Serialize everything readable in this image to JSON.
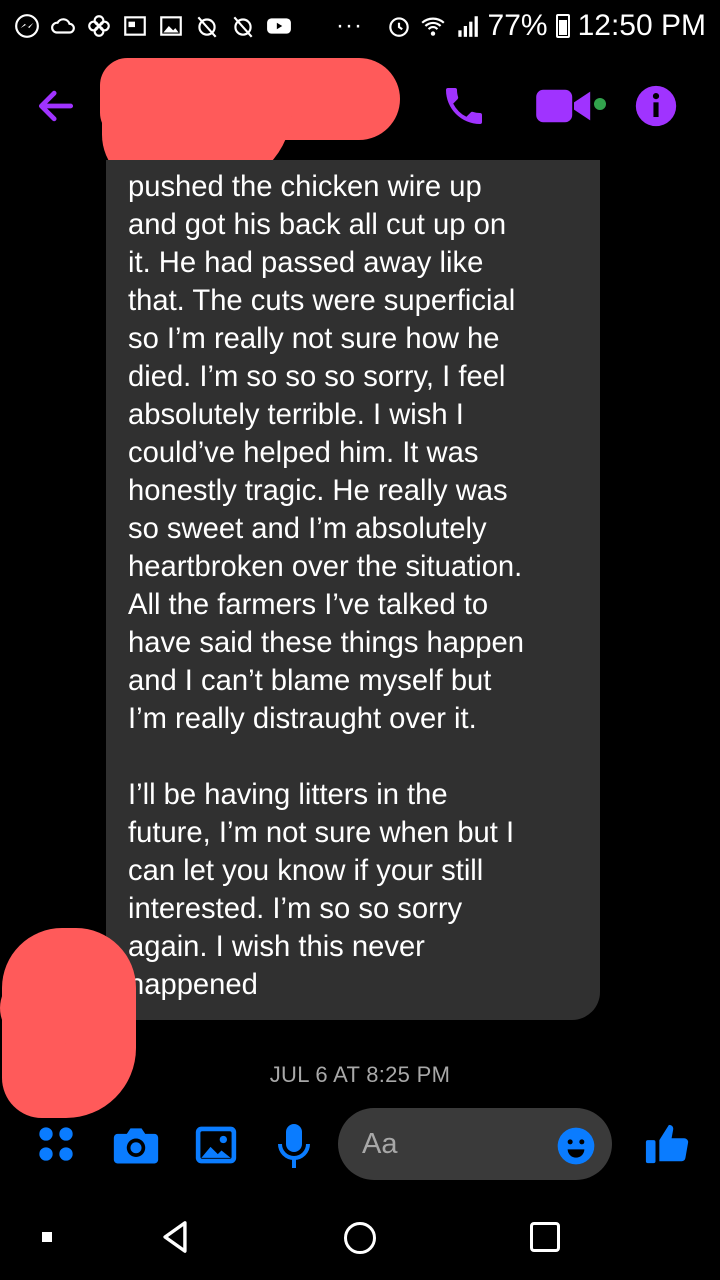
{
  "status_bar": {
    "battery_percent": "77%",
    "time": "12:50 PM",
    "overflow": "···"
  },
  "header": {
    "contact_name": "",
    "icons": [
      "back-arrow-icon",
      "phone-icon",
      "video-camera-icon",
      "info-icon"
    ]
  },
  "message": {
    "paragraphs": [
      "pushed the chicken wire up\nand got his back all cut up on\nit. He had passed away like\nthat. The cuts were superficial\nso I’m really not sure how he\ndied. I’m so so so sorry, I feel\nabsolutely terrible. I wish I\ncould’ve helped him. It was\nhonestly tragic. He really was\nso sweet and I’m absolutely\nheartbroken over the situation.\nAll the farmers I’ve talked to\nhave said these things happen\nand I can’t blame myself but\nI’m really distraught over it.",
      "I’ll be having litters in the\nfuture, I’m not sure when but I\ncan let you know if your still\ninterested. I’m so so sorry\nagain. I wish this never\nhappened"
    ]
  },
  "timestamp": "JUL 6 AT 8:25 PM",
  "composer": {
    "placeholder": "Aa"
  },
  "colors": {
    "accent_purple": "#a033ff",
    "accent_blue": "#0a7cff",
    "online_green": "#31a24c",
    "bubble_gray": "#303030",
    "redaction": "#ff5a5a"
  }
}
